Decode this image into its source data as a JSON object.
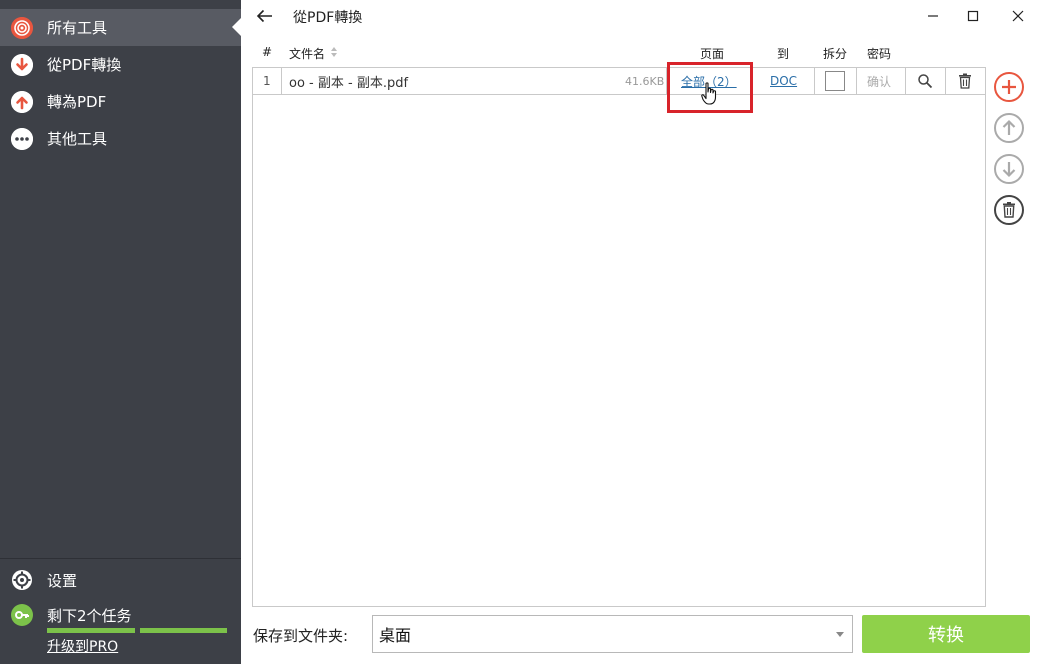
{
  "sidebar": {
    "items": [
      {
        "label": "所有工具",
        "icon": "all-tools-icon"
      },
      {
        "label": "從PDF轉換",
        "icon": "arrow-down-icon"
      },
      {
        "label": "轉為PDF",
        "icon": "arrow-up-icon"
      },
      {
        "label": "其他工具",
        "icon": "more-icon"
      }
    ],
    "settings_label": "设置",
    "tasks_label": "剩下2个任务",
    "tasks_progress_segments": 2,
    "upgrade_label": "升级到PRO"
  },
  "window": {
    "title": "從PDF轉換"
  },
  "table": {
    "headers": {
      "index": "#",
      "filename": "文件名",
      "pages": "页面",
      "to": "到",
      "split": "拆分",
      "password": "密码"
    },
    "rows": [
      {
        "index": "1",
        "filename": "oo - 副本 - 副本.pdf",
        "size": "41.6KB",
        "pages": "全部（2）",
        "to": "DOC",
        "split": false,
        "password": "确认"
      }
    ]
  },
  "footer": {
    "save_label": "保存到文件夹:",
    "folder_value": "桌面",
    "convert_label": "转换"
  },
  "colors": {
    "sidebar_bg": "#3d4047",
    "accent_red": "#e8563f",
    "convert_green": "#8fd14a",
    "link_blue": "#2a6ea8",
    "highlight_red": "#d8232a"
  }
}
